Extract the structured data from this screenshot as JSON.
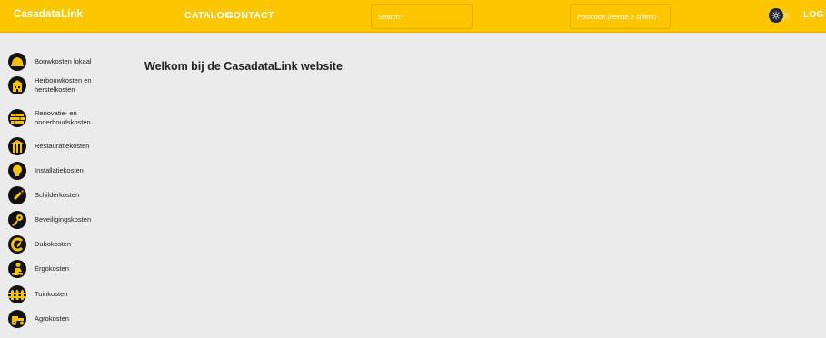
{
  "header": {
    "brand": "CasadataLink",
    "nav": [
      {
        "label": "CATALOG"
      },
      {
        "label": "CONTACT"
      }
    ],
    "search": {
      "placeholder": "Search *",
      "value": ""
    },
    "postcode": {
      "placeholder": "Postcode (eerste 2 cijfers)",
      "value": ""
    },
    "theme_toggle_icon": "sun-icon",
    "login_label": "LOG IN"
  },
  "sidebar": {
    "items": [
      {
        "label": "Bouwkosten lokaal",
        "icon": "hardhat-icon"
      },
      {
        "label": "Herbouwkosten en herstelkosten",
        "icon": "building-icon"
      },
      {
        "label": "Renovatie- en onderhoudskosten",
        "icon": "bricks-icon"
      },
      {
        "label": "Restauratiekosten",
        "icon": "columns-icon"
      },
      {
        "label": "Installatiekosten",
        "icon": "lightbulb-icon"
      },
      {
        "label": "Schilderkosten",
        "icon": "paintbrush-icon"
      },
      {
        "label": "Beveiligingskosten",
        "icon": "key-icon"
      },
      {
        "label": "Dubokosten",
        "icon": "eco-icon"
      },
      {
        "label": "Ergokosten",
        "icon": "person-icon"
      },
      {
        "label": "Tuinkosten",
        "icon": "fence-icon"
      },
      {
        "label": "Agrokosten",
        "icon": "tractor-icon"
      }
    ]
  },
  "main": {
    "title": "Welkom bij de CasadataLink website"
  },
  "colors": {
    "header_bg": "#fdc700",
    "page_bg": "#ebebeb",
    "icon_bg": "#111111",
    "icon_accent": "#f5c200"
  }
}
